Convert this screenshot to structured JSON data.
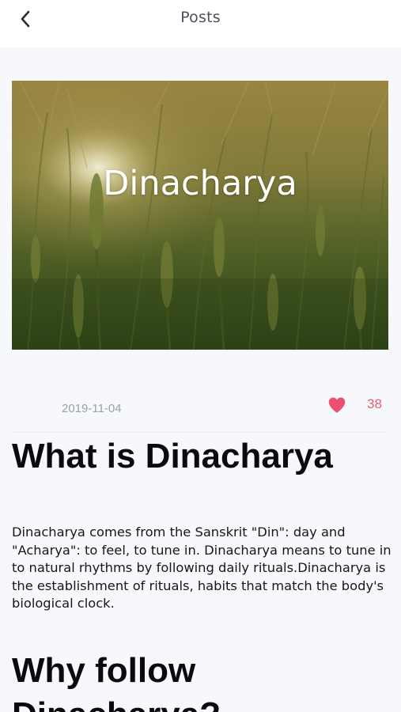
{
  "nav": {
    "title": "Posts",
    "back_icon": "chevron-left-icon"
  },
  "hero": {
    "title": "Dinacharya",
    "image": "wheat-field-sunrise-image"
  },
  "post": {
    "date": "2019-11-04",
    "like_icon": "heart-icon",
    "like_count": "38",
    "heading_1": "What is Dinacharya",
    "body_1": "Dinacharya comes from the Sanskrit \"Din\": day and \"Acharya\": to feel, to tune in. Dinacharya means to tune in to natural rhythms by following daily rituals.Dinacharya is the establishment of rituals, habits that match the body's biological clock.",
    "heading_2": "Why follow Dinacharya?"
  },
  "colors": {
    "accent": "#ec4f74",
    "like_count": "#e0607a",
    "date": "#9da0aa",
    "background": "#f7f8fc"
  }
}
